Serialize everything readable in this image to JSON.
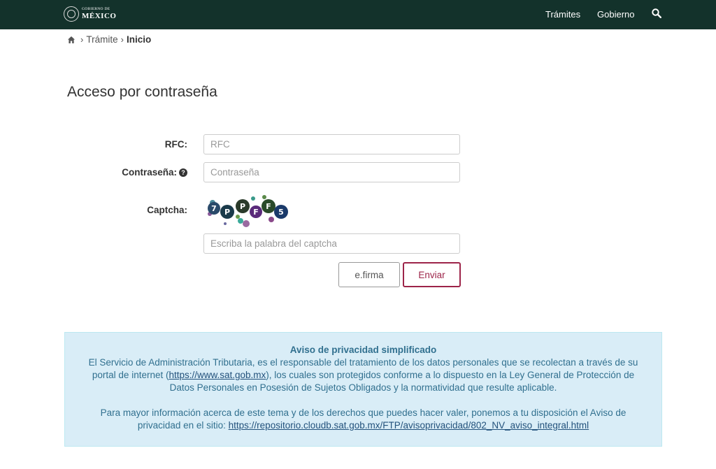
{
  "header": {
    "logo_small": "GOBIERNO DE",
    "logo_big": "MÉXICO",
    "nav": [
      {
        "label": "Trámites"
      },
      {
        "label": "Gobierno"
      }
    ],
    "search_icon": "search-icon",
    "bg_color": "#13322b"
  },
  "breadcrumb": {
    "home_icon": "home-icon",
    "items": [
      "Trámite",
      "Inicio"
    ]
  },
  "page": {
    "title": "Acceso por contraseña"
  },
  "form": {
    "rfc_label": "RFC:",
    "rfc_placeholder": "RFC",
    "password_label": "Contraseña:",
    "password_placeholder": "Contraseña",
    "captcha_label": "Captcha:",
    "captcha_text": [
      "7",
      "P",
      "P",
      "F",
      "F",
      "5"
    ],
    "captcha_placeholder": "Escriba la palabra del captcha",
    "efirma_label": "e.firma",
    "submit_label": "Enviar",
    "accent_color": "#9d2449"
  },
  "privacy": {
    "title": "Aviso de privacidad simplificado",
    "p1_before": "El Servicio de Administración Tributaria, es el responsable del tratamiento de los datos personales que se recolectan a través de su portal de internet (",
    "p1_link": "https://www.sat.gob.mx",
    "p1_after": "), los cuales son protegidos conforme a lo dispuesto en la Ley General de Protección de Datos Personales en Posesión de Sujetos Obligados y la normatividad que resulte aplicable.",
    "p2_before": "Para mayor información acerca de este tema y de los derechos que puedes hacer valer, ponemos a tu disposición el Aviso de privacidad en el sitio: ",
    "p2_link": "https://repositorio.cloudb.sat.gob.mx/FTP/avisoprivacidad/802_NV_aviso_integral.html",
    "bg_color": "#d9edf7"
  }
}
